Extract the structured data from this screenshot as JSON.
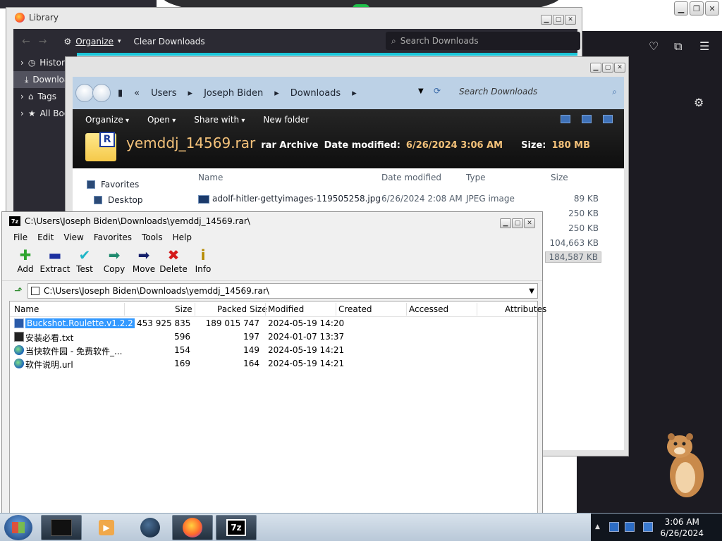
{
  "firefox": {
    "library": {
      "title": "Library",
      "toolbar": {
        "organize": "Organize",
        "clear_downloads": "Clear Downloads",
        "search_placeholder": "Search Downloads"
      },
      "sidebar": [
        "History",
        "Downloads",
        "Tags",
        "All Bookmarks"
      ]
    }
  },
  "explorer": {
    "breadcrumbs": [
      "Users",
      "Joseph Biden",
      "Downloads"
    ],
    "search_placeholder": "Search Downloads",
    "commands": [
      "Organize",
      "Open",
      "Share with",
      "New folder"
    ],
    "details": {
      "file_name": "yemddj_14569.rar",
      "type": "rar Archive",
      "date_label": "Date modified:",
      "date_value": "6/26/2024 3:06 AM",
      "size_label": "Size:",
      "size_value": "180 MB"
    },
    "columns": [
      "Name",
      "Date modified",
      "Type",
      "Size"
    ],
    "favorites": [
      "Favorites",
      "Desktop"
    ],
    "rows": [
      {
        "name": "adolf-hitler-gettyimages-119505258.jpg",
        "date": "6/26/2024 2:08 AM",
        "type": "JPEG image",
        "size": "89 KB"
      },
      {
        "name": "",
        "date": "",
        "type": "",
        "size": "250 KB"
      },
      {
        "name": "",
        "date": "",
        "type": "",
        "size": "250 KB"
      },
      {
        "name": "",
        "date": "",
        "type": "",
        "size": "104,663 KB"
      },
      {
        "name": "",
        "date": "",
        "type": "",
        "size": "184,587 KB"
      }
    ]
  },
  "sevenzip": {
    "title": "C:\\Users\\Joseph Biden\\Downloads\\yemddj_14569.rar\\",
    "menu": [
      "File",
      "Edit",
      "View",
      "Favorites",
      "Tools",
      "Help"
    ],
    "tools": [
      "Add",
      "Extract",
      "Test",
      "Copy",
      "Move",
      "Delete",
      "Info"
    ],
    "path": "C:\\Users\\Joseph Biden\\Downloads\\yemddj_14569.rar\\",
    "columns": [
      "Name",
      "Size",
      "Packed Size",
      "Modified",
      "Created",
      "Accessed",
      "Attributes"
    ],
    "files": [
      {
        "name": "Buckshot.Roulette.v1.2.2",
        "size": "453 925 835",
        "packed": "189 015 747",
        "modified": "2024-05-19 14:20"
      },
      {
        "name": "安装必看.txt",
        "size": "596",
        "packed": "197",
        "modified": "2024-01-07 13:37"
      },
      {
        "name": "当快软件园 - 免费软件_...",
        "size": "154",
        "packed": "149",
        "modified": "2024-05-19 14:21"
      },
      {
        "name": "软件说明.url",
        "size": "169",
        "packed": "164",
        "modified": "2024-05-19 14:21"
      }
    ]
  },
  "taskbar": {
    "time": "3:06 AM",
    "date": "6/26/2024"
  },
  "colors": {
    "accent": "#1bc6d9",
    "selection": "#3399ff",
    "firefox_dark": "#2b2a33"
  }
}
